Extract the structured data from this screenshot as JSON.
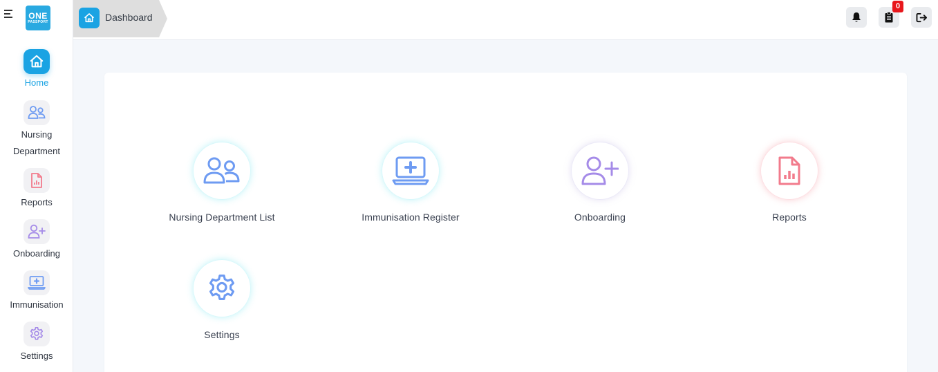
{
  "app": {
    "logo_line1": "ONE",
    "logo_line2": "PASSPORT"
  },
  "sidebar": {
    "items": [
      {
        "label": "Home",
        "icon": "home-icon",
        "active": true
      },
      {
        "label": "Nursing Department",
        "icon": "users-icon",
        "active": false
      },
      {
        "label": "Reports",
        "icon": "report-file-icon",
        "active": false
      },
      {
        "label": "Onboarding",
        "icon": "user-plus-icon",
        "active": false
      },
      {
        "label": "Immunisation",
        "icon": "laptop-medical-icon",
        "active": false
      },
      {
        "label": "Settings",
        "icon": "gear-icon",
        "active": false
      }
    ]
  },
  "header": {
    "breadcrumb": "Dashboard",
    "notification_icon": "bell-icon",
    "tasks_icon": "clipboard-icon",
    "tasks_count": "0",
    "logout_icon": "logout-icon"
  },
  "dashboard": {
    "tiles": [
      {
        "label": "Nursing Department List",
        "icon": "users-icon",
        "color": "#6e9bf2"
      },
      {
        "label": "Immunisation Register",
        "icon": "laptop-medical-icon",
        "color": "#6e9bf2"
      },
      {
        "label": "Onboarding",
        "icon": "user-plus-icon",
        "color": "#a58be8"
      },
      {
        "label": "Reports",
        "icon": "report-file-icon",
        "color": "#f27b8c"
      },
      {
        "label": "Settings",
        "icon": "gear-icon",
        "color": "#6e9bf2"
      }
    ]
  },
  "colors": {
    "accent": "#1aa3e3",
    "badge": "#e8171c"
  }
}
